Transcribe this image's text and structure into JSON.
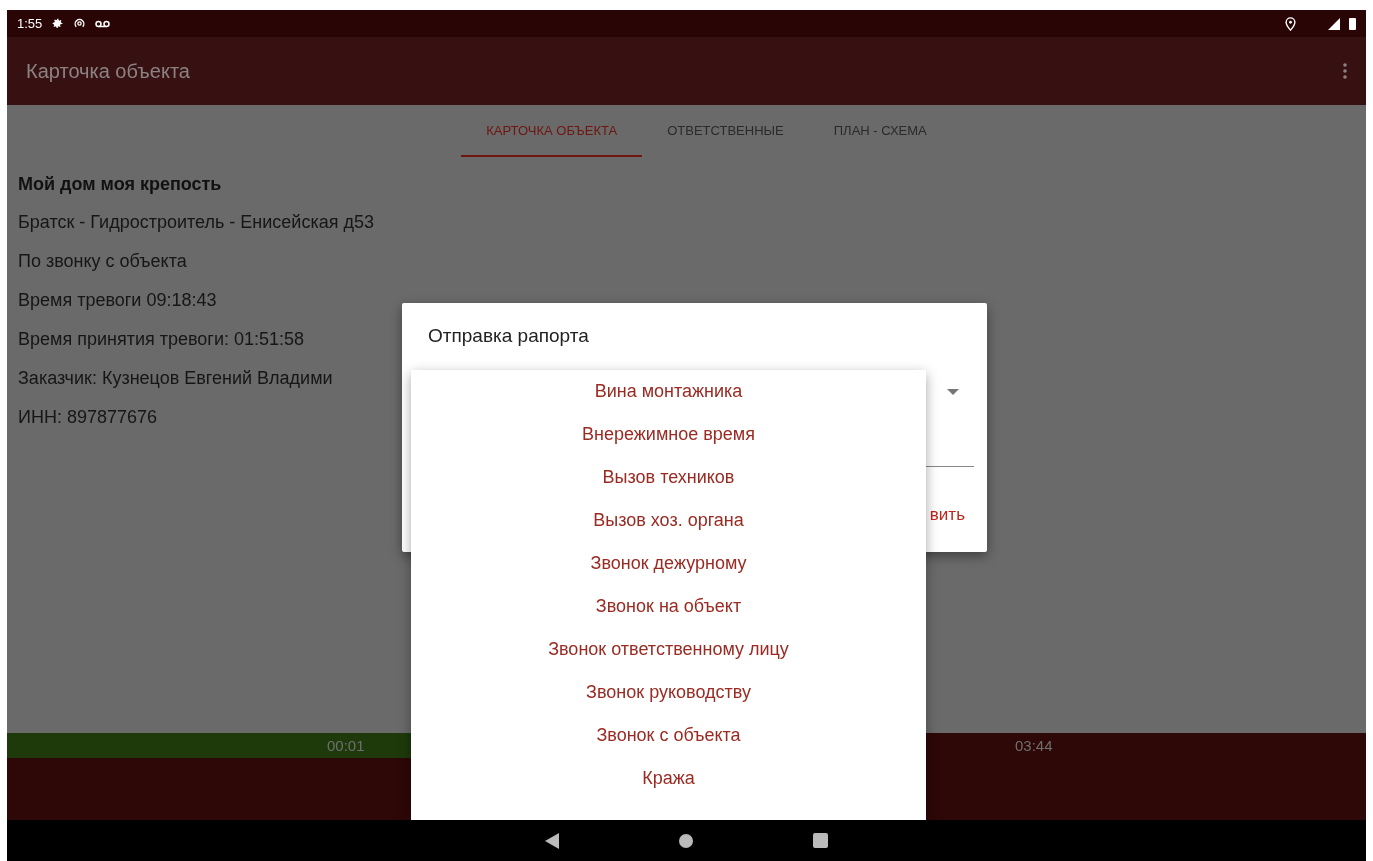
{
  "status_bar": {
    "time": "1:55"
  },
  "app_bar": {
    "title": "Карточка объекта"
  },
  "tabs": [
    {
      "label": "КАРТОЧКА ОБЪЕКТА",
      "selected": true
    },
    {
      "label": "ОТВЕТСТВЕННЫЕ",
      "selected": false
    },
    {
      "label": "ПЛАН - СХЕМА",
      "selected": false
    }
  ],
  "object": {
    "name": "Мой дом моя крепость",
    "lines": [
      "Братск - Гидростроитель - Енисейская д53",
      "По звонку с объекта",
      "Время тревоги 09:18:43",
      "Время принятия тревоги: 01:51:58",
      "Заказчик: Кузнецов Евгений Владими",
      "ИНН: 897877676"
    ]
  },
  "timer_bar": {
    "level": 0.3,
    "elapsed": "00:01",
    "remaining": "03:44"
  },
  "dialog": {
    "title": "Отправка рапорта",
    "button": "вить",
    "options": [
      "Вина монтажника",
      "Внережимное время",
      "Вызов техников",
      "Вызов хоз. органа",
      "Звонок дежурному",
      "Звонок на объект",
      "Звонок ответственному лицу",
      "Звонок руководству",
      "Звонок с объекта",
      "Кража"
    ]
  }
}
